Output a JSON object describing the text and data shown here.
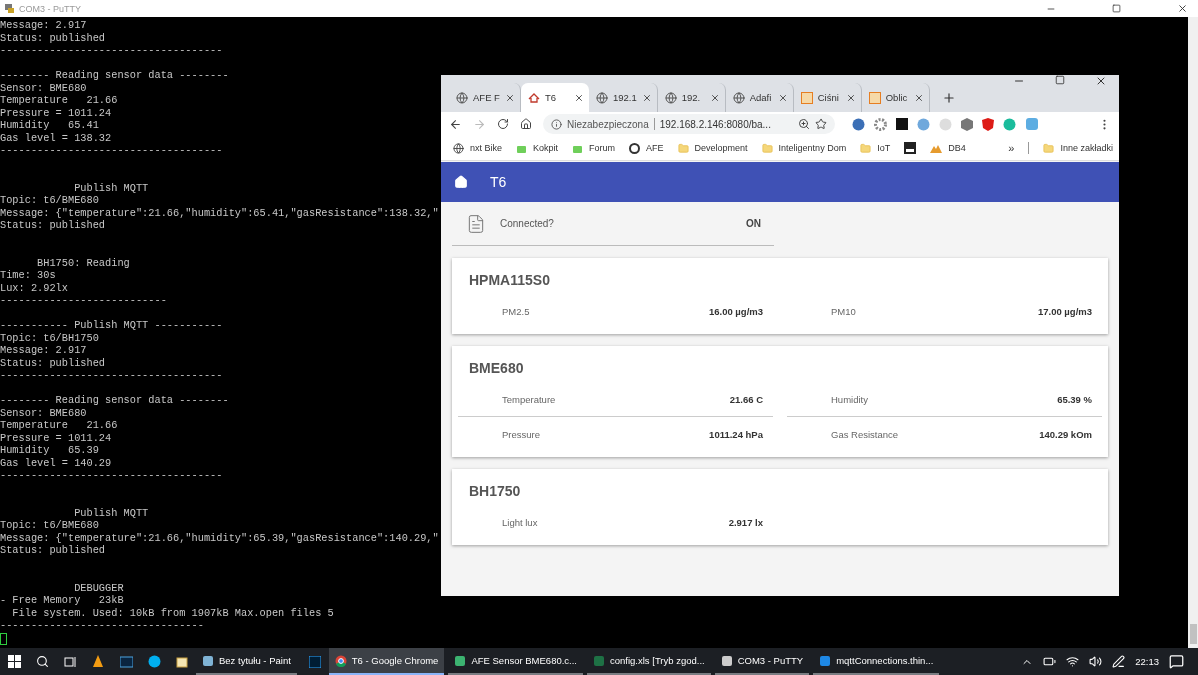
{
  "putty": {
    "title": "COM3 - PuTTY",
    "lines": [
      {
        "kind": "text",
        "text": "Message: 2.917"
      },
      {
        "kind": "text",
        "text": "Status: published"
      },
      {
        "kind": "text",
        "text": "------------------------------------"
      },
      {
        "kind": "blank"
      },
      {
        "kind": "text",
        "text": "-------- Reading sensor data --------"
      },
      {
        "kind": "text",
        "text": "Sensor: BME680"
      },
      {
        "kind": "text",
        "text": "Temperature   21.66"
      },
      {
        "kind": "text",
        "text": "Pressure = 1011.24"
      },
      {
        "kind": "text",
        "text": "Humidity   65.41"
      },
      {
        "kind": "text",
        "text": "Gas level = 138.32"
      },
      {
        "kind": "text",
        "text": "------------------------------------"
      },
      {
        "kind": "blank"
      },
      {
        "kind": "blank"
      },
      {
        "kind": "text",
        "text": "            Publish MQTT"
      },
      {
        "kind": "text",
        "text": "Topic: t6/BME680"
      },
      {
        "kind": "text",
        "text": "Message: {\"temperature\":21.66,\"humidity\":65.41,\"gasResistance\":138.32,\""
      },
      {
        "kind": "text",
        "text": "Status: published"
      },
      {
        "kind": "blank"
      },
      {
        "kind": "blank"
      },
      {
        "kind": "text",
        "text": "      BH1750: Reading"
      },
      {
        "kind": "text",
        "text": "Time: 30s"
      },
      {
        "kind": "text",
        "text": "Lux: 2.92lx"
      },
      {
        "kind": "text",
        "text": "---------------------------"
      },
      {
        "kind": "blank"
      },
      {
        "kind": "text",
        "text": "----------- Publish MQTT -----------"
      },
      {
        "kind": "text",
        "text": "Topic: t6/BH1750"
      },
      {
        "kind": "text",
        "text": "Message: 2.917"
      },
      {
        "kind": "text",
        "text": "Status: published"
      },
      {
        "kind": "text",
        "text": "------------------------------------"
      },
      {
        "kind": "blank"
      },
      {
        "kind": "text",
        "text": "-------- Reading sensor data --------"
      },
      {
        "kind": "text",
        "text": "Sensor: BME680"
      },
      {
        "kind": "text",
        "text": "Temperature   21.66"
      },
      {
        "kind": "text",
        "text": "Pressure = 1011.24"
      },
      {
        "kind": "text",
        "text": "Humidity   65.39"
      },
      {
        "kind": "text",
        "text": "Gas level = 140.29"
      },
      {
        "kind": "text",
        "text": "------------------------------------"
      },
      {
        "kind": "blank"
      },
      {
        "kind": "blank"
      },
      {
        "kind": "text",
        "text": "            Publish MQTT"
      },
      {
        "kind": "text",
        "text": "Topic: t6/BME680"
      },
      {
        "kind": "text",
        "text": "Message: {\"temperature\":21.66,\"humidity\":65.39,\"gasResistance\":140.29,\""
      },
      {
        "kind": "text",
        "text": "Status: published"
      },
      {
        "kind": "blank"
      },
      {
        "kind": "blank"
      },
      {
        "kind": "text",
        "text": "            DEBUGGER"
      },
      {
        "kind": "text",
        "text": "- Free Memory   23kB"
      },
      {
        "kind": "text",
        "text": "  File system. Used: 10kB from 1907kB Max.open files 5"
      },
      {
        "kind": "text",
        "text": "---------------------------------"
      },
      {
        "kind": "cursor"
      }
    ]
  },
  "browser": {
    "tabs": [
      {
        "label": "AFE F",
        "selected": false
      },
      {
        "label": "T6",
        "selected": true
      },
      {
        "label": "192.1",
        "selected": false
      },
      {
        "label": "192.",
        "selected": false
      },
      {
        "label": "Adafi",
        "selected": false
      },
      {
        "label": "Ciśni",
        "selected": false
      },
      {
        "label": "Oblic",
        "selected": false
      }
    ],
    "address": {
      "security": "Niezabezpieczona",
      "url": "192.168.2.146:8080/ba..."
    },
    "bookmarks": [
      {
        "label": "nxt Bike"
      },
      {
        "label": "Kokpit"
      },
      {
        "label": "Forum"
      },
      {
        "label": "AFE"
      },
      {
        "label": "Development"
      },
      {
        "label": "Inteligentny Dom"
      },
      {
        "label": "IoT"
      },
      {
        "label": "DB4"
      }
    ],
    "bookmarks_overflow": "»",
    "other_bookmarks": "Inne zakładki",
    "app": {
      "title": "T6",
      "status": {
        "label": "Connected?",
        "value": "ON"
      },
      "cards": [
        {
          "title": "HPMA115S0",
          "readings": [
            {
              "label": "PM2.5",
              "value": "16.00 µg/m3"
            },
            {
              "label": "PM10",
              "value": "17.00 µg/m3"
            }
          ]
        },
        {
          "title": "BME680",
          "readings": [
            {
              "label": "Temperature",
              "value": "21.66 C"
            },
            {
              "label": "Humidity",
              "value": "65.39 %"
            },
            {
              "label": "Pressure",
              "value": "1011.24 hPa"
            },
            {
              "label": "Gas Resistance",
              "value": "140.29 kOm"
            }
          ]
        },
        {
          "title": "BH1750",
          "readings": [
            {
              "label": "Light lux",
              "value": "2.917 lx"
            }
          ]
        }
      ]
    }
  },
  "taskbar": {
    "apps": [
      {
        "label": "Bez tytułu - Paint",
        "selected": false
      },
      {
        "label": "T6 - Google Chrome",
        "selected": true
      },
      {
        "label": "AFE Sensor BME680.c...",
        "selected": false
      },
      {
        "label": "config.xls [Tryb zgod...",
        "selected": false
      },
      {
        "label": "COM3 - PuTTY",
        "selected": false
      },
      {
        "label": "mqttConnections.thin...",
        "selected": false
      }
    ],
    "clock": "22:13"
  }
}
